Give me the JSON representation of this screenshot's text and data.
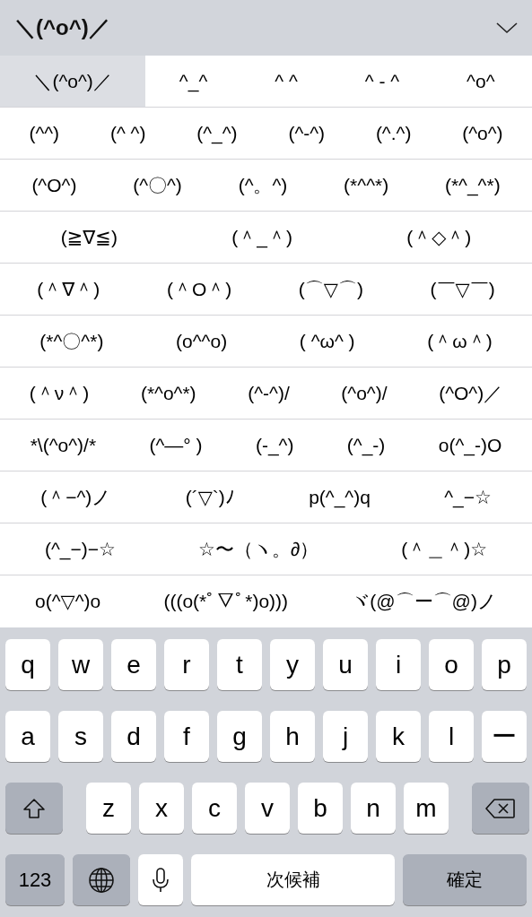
{
  "composition": {
    "text": "＼(^o^)／"
  },
  "candidates": [
    [
      {
        "text": "＼(^o^)／",
        "selected": true
      },
      {
        "text": "^_^",
        "selected": false
      },
      {
        "text": "^ ^",
        "selected": false
      },
      {
        "text": "^ - ^",
        "selected": false
      },
      {
        "text": "^o^",
        "selected": false
      }
    ],
    [
      {
        "text": "(^^)",
        "selected": false
      },
      {
        "text": "(^ ^)",
        "selected": false
      },
      {
        "text": "(^_^)",
        "selected": false
      },
      {
        "text": "(^-^)",
        "selected": false
      },
      {
        "text": "(^.^)",
        "selected": false
      },
      {
        "text": "(^o^)",
        "selected": false
      }
    ],
    [
      {
        "text": "(^O^)",
        "selected": false
      },
      {
        "text": "(^〇^)",
        "selected": false
      },
      {
        "text": "(^。^)",
        "selected": false
      },
      {
        "text": "(*^^*)",
        "selected": false
      },
      {
        "text": "(*^_^*)",
        "selected": false
      }
    ],
    [
      {
        "text": "(≧∇≦)",
        "selected": false
      },
      {
        "text": "(＾_＾)",
        "selected": false
      },
      {
        "text": "(＾◇＾)",
        "selected": false
      }
    ],
    [
      {
        "text": "(＾∇＾)",
        "selected": false
      },
      {
        "text": "(＾O＾)",
        "selected": false
      },
      {
        "text": "(⌒▽⌒)",
        "selected": false
      },
      {
        "text": "(￣▽￣)",
        "selected": false
      }
    ],
    [
      {
        "text": "(*^〇^*)",
        "selected": false
      },
      {
        "text": "(o^^o)",
        "selected": false
      },
      {
        "text": "( ^ω^ )",
        "selected": false
      },
      {
        "text": "(＾ω＾)",
        "selected": false
      }
    ],
    [
      {
        "text": "(＾ν＾)",
        "selected": false
      },
      {
        "text": "(*^o^*)",
        "selected": false
      },
      {
        "text": "(^-^)/",
        "selected": false
      },
      {
        "text": "(^o^)/",
        "selected": false
      },
      {
        "text": "(^O^)／",
        "selected": false
      }
    ],
    [
      {
        "text": "*\\(^o^)/*",
        "selected": false
      },
      {
        "text": "(^—° )",
        "selected": false
      },
      {
        "text": "(-_^)",
        "selected": false
      },
      {
        "text": "(^_-)",
        "selected": false
      },
      {
        "text": "o(^_-)O",
        "selected": false
      }
    ],
    [
      {
        "text": "(＾−^)ノ",
        "selected": false
      },
      {
        "text": "(´▽`)ﾉ",
        "selected": false
      },
      {
        "text": "p(^_^)q",
        "selected": false
      },
      {
        "text": "^_−☆",
        "selected": false
      }
    ],
    [
      {
        "text": "(^_−)−☆",
        "selected": false
      },
      {
        "text": "☆〜（ヽ。∂）",
        "selected": false
      },
      {
        "text": "(＾＿＾)☆",
        "selected": false
      }
    ],
    [
      {
        "text": "o(^▽^)o",
        "selected": false
      },
      {
        "text": "(((o(*ﾟ▽ﾟ*)o)))",
        "selected": false
      },
      {
        "text": "ヾ(@⌒ー⌒@)ノ",
        "selected": false
      }
    ]
  ],
  "keyboard": [
    [
      {
        "kind": "letter",
        "label": "q"
      },
      {
        "kind": "letter",
        "label": "w"
      },
      {
        "kind": "letter",
        "label": "e"
      },
      {
        "kind": "letter",
        "label": "r"
      },
      {
        "kind": "letter",
        "label": "t"
      },
      {
        "kind": "letter",
        "label": "y"
      },
      {
        "kind": "letter",
        "label": "u"
      },
      {
        "kind": "letter",
        "label": "i"
      },
      {
        "kind": "letter",
        "label": "o"
      },
      {
        "kind": "letter",
        "label": "p"
      }
    ],
    [
      {
        "kind": "letter",
        "label": "a"
      },
      {
        "kind": "letter",
        "label": "s"
      },
      {
        "kind": "letter",
        "label": "d"
      },
      {
        "kind": "letter",
        "label": "f"
      },
      {
        "kind": "letter",
        "label": "g"
      },
      {
        "kind": "letter",
        "label": "h"
      },
      {
        "kind": "letter",
        "label": "j"
      },
      {
        "kind": "letter",
        "label": "k"
      },
      {
        "kind": "letter",
        "label": "l"
      },
      {
        "kind": "letter",
        "label": "ー"
      }
    ],
    [
      {
        "kind": "shift"
      },
      {
        "kind": "letter",
        "label": "z"
      },
      {
        "kind": "letter",
        "label": "x"
      },
      {
        "kind": "letter",
        "label": "c"
      },
      {
        "kind": "letter",
        "label": "v"
      },
      {
        "kind": "letter",
        "label": "b"
      },
      {
        "kind": "letter",
        "label": "n"
      },
      {
        "kind": "letter",
        "label": "m"
      },
      {
        "kind": "delete"
      }
    ],
    [
      {
        "kind": "numbers",
        "label": "123"
      },
      {
        "kind": "globe"
      },
      {
        "kind": "mic"
      },
      {
        "kind": "space",
        "label": "次候補"
      },
      {
        "kind": "return",
        "label": "確定"
      }
    ]
  ]
}
